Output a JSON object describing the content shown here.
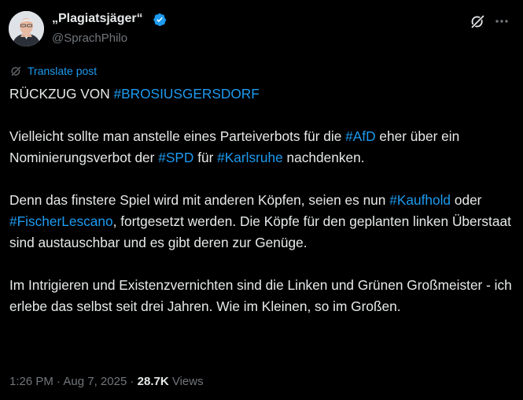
{
  "author": {
    "name": "„Plagiatsjäger“",
    "handle": "@SprachPhilo"
  },
  "translate_label": "Translate post",
  "post": {
    "p1": {
      "text": "RÜCKZUG VON ",
      "tag": "#BROSIUSGERSDORF"
    },
    "p2": {
      "t1": "Vielleicht sollte man anstelle eines Parteiverbots für die ",
      "tag1": "#AfD",
      "t2": " eher über ein Nominierungsverbot der ",
      "tag2": "#SPD",
      "t3": " für ",
      "tag3": "#Karlsruhe",
      "t4": " nachdenken."
    },
    "p3": {
      "t1": "Denn das finstere Spiel wird mit anderen Köpfen, seien es nun ",
      "tag1": "#Kaufhold",
      "t2": " oder ",
      "tag2": "#FischerLescano",
      "t3": ", fortgesetzt werden. Die Köpfe für den geplanten linken Überstaat sind austauschbar und es gibt deren zur Genüge."
    },
    "p4": "Im Intrigieren und Existenzvernichten sind die Linken und Grünen Großmeister - ich erlebe das selbst seit drei Jahren. Wie im Kleinen, so im Großen."
  },
  "meta": {
    "time": "1:26 PM",
    "date": "Aug 7, 2025",
    "views_count": "28.7K",
    "views_label": "Views"
  },
  "colors": {
    "background": "#000000",
    "text": "#e7e9ea",
    "secondary": "#71767b",
    "link": "#1d9bf0",
    "verified": "#1d9bf0"
  },
  "icons": {
    "verified": "verified-badge-icon",
    "grok": "grok-icon",
    "more": "more-icon",
    "translate": "translate-icon"
  }
}
